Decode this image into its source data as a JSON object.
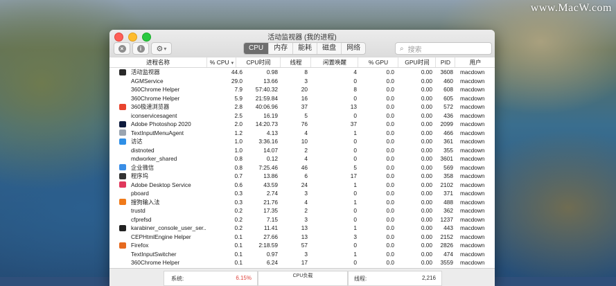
{
  "watermark": "www.MacW.com",
  "window": {
    "title": "活动监视器 (我的进程)"
  },
  "toolbar": {
    "close_label": "×",
    "info_label": "i",
    "gear_label": "⚙",
    "gear_arrow": "▾"
  },
  "tabs": [
    "CPU",
    "内存",
    "能耗",
    "磁盘",
    "网络"
  ],
  "active_tab": "CPU",
  "search": {
    "placeholder": "搜索"
  },
  "columns": [
    "进程名称",
    "% CPU",
    "CPU时间",
    "线程",
    "闲置唤醒",
    "% GPU",
    "GPU时间",
    "PID",
    "用户"
  ],
  "rows": [
    {
      "name": "活动监视器",
      "cpu": "44.6",
      "time": "0.98",
      "threads": "8",
      "idle": "4",
      "gpu": "0.0",
      "gtime": "0.00",
      "pid": "3608",
      "user": "macdown",
      "icon": "activity-monitor-icon",
      "color": "#2a2a2a"
    },
    {
      "name": "AGMService",
      "cpu": "29.0",
      "time": "13.66",
      "threads": "3",
      "idle": "0",
      "gpu": "0.0",
      "gtime": "0.00",
      "pid": "460",
      "user": "macdown",
      "icon": "",
      "color": ""
    },
    {
      "name": "360Chrome Helper",
      "cpu": "7.9",
      "time": "57:40.32",
      "threads": "20",
      "idle": "8",
      "gpu": "0.0",
      "gtime": "0.00",
      "pid": "608",
      "user": "macdown",
      "icon": "",
      "color": ""
    },
    {
      "name": "360Chrome Helper",
      "cpu": "5.9",
      "time": "21:59.84",
      "threads": "16",
      "idle": "0",
      "gpu": "0.0",
      "gtime": "0.00",
      "pid": "605",
      "user": "macdown",
      "icon": "",
      "color": ""
    },
    {
      "name": "360极速浏览器",
      "cpu": "2.8",
      "time": "40:06.96",
      "threads": "37",
      "idle": "13",
      "gpu": "0.0",
      "gtime": "0.00",
      "pid": "572",
      "user": "macdown",
      "icon": "browser-360-icon",
      "color": "#e8442e"
    },
    {
      "name": "iconservicesagent",
      "cpu": "2.5",
      "time": "16.19",
      "threads": "5",
      "idle": "0",
      "gpu": "0.0",
      "gtime": "0.00",
      "pid": "436",
      "user": "macdown",
      "icon": "",
      "color": ""
    },
    {
      "name": "Adobe Photoshop 2020",
      "cpu": "2.0",
      "time": "14:20.73",
      "threads": "76",
      "idle": "37",
      "gpu": "0.0",
      "gtime": "0.00",
      "pid": "2099",
      "user": "macdown",
      "icon": "photoshop-icon",
      "color": "#0d1b3d"
    },
    {
      "name": "TextInputMenuAgent",
      "cpu": "1.2",
      "time": "4.13",
      "threads": "4",
      "idle": "1",
      "gpu": "0.0",
      "gtime": "0.00",
      "pid": "466",
      "user": "macdown",
      "icon": "text-input-icon",
      "color": "#9aa4b0"
    },
    {
      "name": "访达",
      "cpu": "1.0",
      "time": "3:36.16",
      "threads": "10",
      "idle": "0",
      "gpu": "0.0",
      "gtime": "0.00",
      "pid": "361",
      "user": "macdown",
      "icon": "finder-icon",
      "color": "#2f8fe6"
    },
    {
      "name": "distnoted",
      "cpu": "1.0",
      "time": "14.07",
      "threads": "2",
      "idle": "0",
      "gpu": "0.0",
      "gtime": "0.00",
      "pid": "355",
      "user": "macdown",
      "icon": "",
      "color": ""
    },
    {
      "name": "mdworker_shared",
      "cpu": "0.8",
      "time": "0.12",
      "threads": "4",
      "idle": "0",
      "gpu": "0.0",
      "gtime": "0.00",
      "pid": "3601",
      "user": "macdown",
      "icon": "",
      "color": ""
    },
    {
      "name": "企业微信",
      "cpu": "0.8",
      "time": "7:25.46",
      "threads": "46",
      "idle": "5",
      "gpu": "0.0",
      "gtime": "0.00",
      "pid": "569",
      "user": "macdown",
      "icon": "wecom-icon",
      "color": "#3a8ee6"
    },
    {
      "name": "程序坞",
      "cpu": "0.7",
      "time": "13.86",
      "threads": "6",
      "idle": "17",
      "gpu": "0.0",
      "gtime": "0.00",
      "pid": "358",
      "user": "macdown",
      "icon": "dock-icon",
      "color": "#333333"
    },
    {
      "name": "Adobe Desktop Service",
      "cpu": "0.6",
      "time": "43.59",
      "threads": "24",
      "idle": "1",
      "gpu": "0.0",
      "gtime": "0.00",
      "pid": "2102",
      "user": "macdown",
      "icon": "creative-cloud-icon",
      "color": "#e0385c"
    },
    {
      "name": "pboard",
      "cpu": "0.3",
      "time": "2.74",
      "threads": "3",
      "idle": "0",
      "gpu": "0.0",
      "gtime": "0.00",
      "pid": "371",
      "user": "macdown",
      "icon": "",
      "color": ""
    },
    {
      "name": "搜狗输入法",
      "cpu": "0.3",
      "time": "21.76",
      "threads": "4",
      "idle": "1",
      "gpu": "0.0",
      "gtime": "0.00",
      "pid": "488",
      "user": "macdown",
      "icon": "sogou-icon",
      "color": "#f07a1a"
    },
    {
      "name": "trustd",
      "cpu": "0.2",
      "time": "17.35",
      "threads": "2",
      "idle": "0",
      "gpu": "0.0",
      "gtime": "0.00",
      "pid": "362",
      "user": "macdown",
      "icon": "",
      "color": ""
    },
    {
      "name": "cfprefsd",
      "cpu": "0.2",
      "time": "7.15",
      "threads": "3",
      "idle": "0",
      "gpu": "0.0",
      "gtime": "0.00",
      "pid": "1237",
      "user": "macdown",
      "icon": "",
      "color": ""
    },
    {
      "name": "karabiner_console_user_ser...",
      "cpu": "0.2",
      "time": "11.41",
      "threads": "13",
      "idle": "1",
      "gpu": "0.0",
      "gtime": "0.00",
      "pid": "443",
      "user": "macdown",
      "icon": "karabiner-icon",
      "color": "#222222"
    },
    {
      "name": "CEPHtmlEngine Helper",
      "cpu": "0.1",
      "time": "27.66",
      "threads": "13",
      "idle": "3",
      "gpu": "0.0",
      "gtime": "0.00",
      "pid": "2152",
      "user": "macdown",
      "icon": "",
      "color": ""
    },
    {
      "name": "Firefox",
      "cpu": "0.1",
      "time": "2:18.59",
      "threads": "57",
      "idle": "0",
      "gpu": "0.0",
      "gtime": "0.00",
      "pid": "2826",
      "user": "macdown",
      "icon": "firefox-icon",
      "color": "#e66a1f"
    },
    {
      "name": "TextInputSwitcher",
      "cpu": "0.1",
      "time": "0.97",
      "threads": "3",
      "idle": "1",
      "gpu": "0.0",
      "gtime": "0.00",
      "pid": "474",
      "user": "macdown",
      "icon": "",
      "color": ""
    },
    {
      "name": "360Chrome Helper",
      "cpu": "0.1",
      "time": "6.24",
      "threads": "17",
      "idle": "0",
      "gpu": "0.0",
      "gtime": "0.00",
      "pid": "3559",
      "user": "macdown",
      "icon": "",
      "color": ""
    }
  ],
  "footer": {
    "system_label": "系统:",
    "system_value": "6.15%",
    "load_label": "CPU负载",
    "threads_label": "线程:",
    "threads_value": "2,216"
  }
}
